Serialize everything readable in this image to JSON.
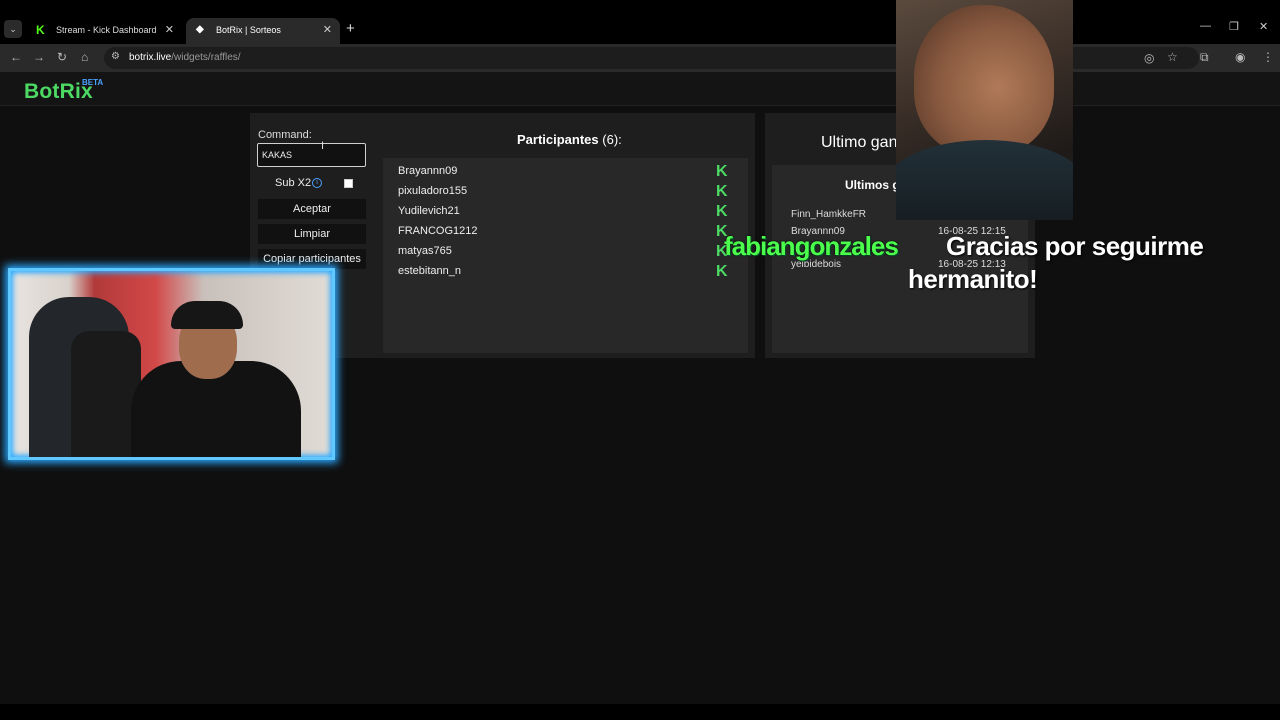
{
  "browser": {
    "tabs": [
      {
        "title": "Stream - Kick Dashboard",
        "favicon": "K"
      },
      {
        "title": "BotRix | Sorteos",
        "favicon": "◆"
      }
    ],
    "url_host": "botrix.live",
    "url_path": "/widgets/raffles/"
  },
  "site": {
    "logo": "BotRix",
    "badge": "BETA"
  },
  "raffle": {
    "command_label": "Command:",
    "command_value": "KAKAS",
    "sub_label": "Sub X2",
    "accept_label": "Aceptar",
    "clear_label": "Limpiar",
    "copy_label": "Copiar participantes"
  },
  "participants": {
    "title": "Participantes",
    "count": "(6):",
    "items": [
      {
        "name": "Brayannn09",
        "platform": "K"
      },
      {
        "name": "pixuladoro155",
        "platform": "K"
      },
      {
        "name": "Yudilevich21",
        "platform": "K"
      },
      {
        "name": "FRANCOG1212",
        "platform": "K"
      },
      {
        "name": "matyas765",
        "platform": "K"
      },
      {
        "name": "estebitann_n",
        "platform": "K"
      }
    ]
  },
  "winners": {
    "last_winner_title": "Ultimo gan",
    "last_winners_title": "Ultimos g",
    "rows": [
      {
        "name": "Finn_HamkkeFR",
        "date": ""
      },
      {
        "name": "Brayannn09",
        "date": "16-08-25 12:15"
      },
      {
        "name": "",
        "date": ""
      },
      {
        "name": "yeibidebois",
        "date": "16-08-25 12:13"
      }
    ]
  },
  "alert": {
    "name": "fabiangonzales",
    "line1": "Gracias por seguirme",
    "line2": "hermanito!"
  },
  "colors": {
    "accent_green": "#4cd964",
    "alert_green": "#4cff4c",
    "info_blue": "#4aa3ff",
    "cam_glow": "#2aa8ff"
  }
}
